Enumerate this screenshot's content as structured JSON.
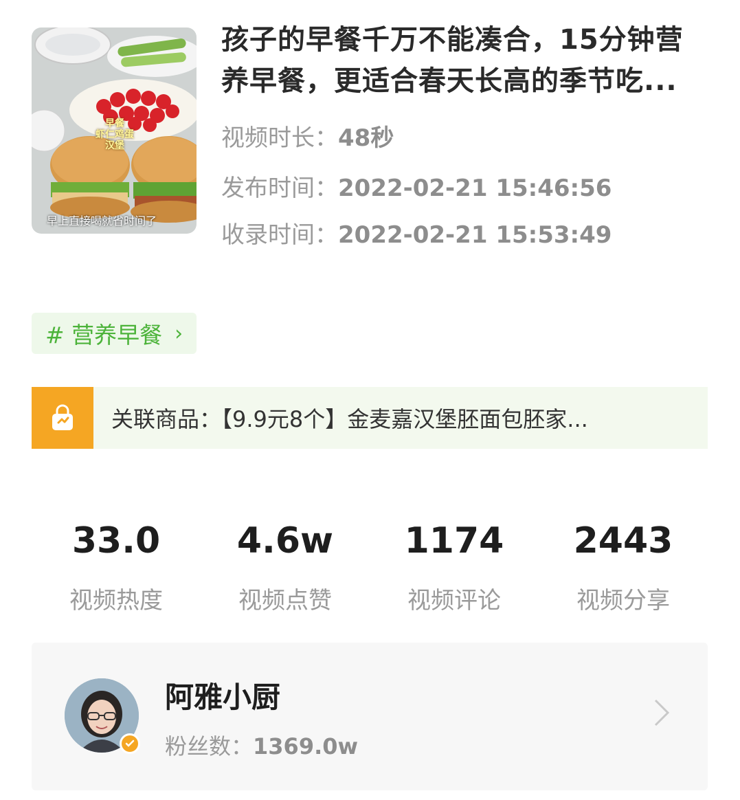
{
  "video": {
    "thumbnail": {
      "overlay_top": "早餐\n虾仁鸡蛋\n汉堡",
      "overlay_top_lines": [
        "早餐",
        "虾仁鸡蛋",
        "汉堡"
      ],
      "overlay_bottom": "早上直接喝就省时间了"
    },
    "title": "孩子的早餐千万不能凑合，15分钟营养早餐，更适合春天长高的季节吃...",
    "meta": [
      {
        "label": "视频时长：",
        "value": "48秒"
      },
      {
        "label": "发布时间：",
        "value": "2022-02-21 15:46:56"
      },
      {
        "label": "收录时间：",
        "value": "2022-02-21 15:53:49"
      }
    ]
  },
  "tag": {
    "label": "# 营养早餐",
    "arrow": "›"
  },
  "product": {
    "icon": "shopping-bag-icon",
    "label": "关联商品：",
    "text": "【9.9元8个】金麦嘉汉堡胚面包胚家..."
  },
  "stats": [
    {
      "value": "33.0",
      "label": "视频热度"
    },
    {
      "value": "4.6w",
      "label": "视频点赞"
    },
    {
      "value": "1174",
      "label": "视频评论"
    },
    {
      "value": "2443",
      "label": "视频分享"
    }
  ],
  "author": {
    "name": "阿雅小厨",
    "fans_label": "粉丝数：",
    "fans_value": "1369.0w",
    "verified_icon": "verified-check-icon",
    "chevron_icon": "chevron-right-icon"
  },
  "colors": {
    "tag_green": "#4cb33a",
    "tag_bg": "#eef8ea",
    "product_bg": "#f3f9ee",
    "bag_orange": "#f5a623",
    "muted_text": "#9a9a9a"
  }
}
